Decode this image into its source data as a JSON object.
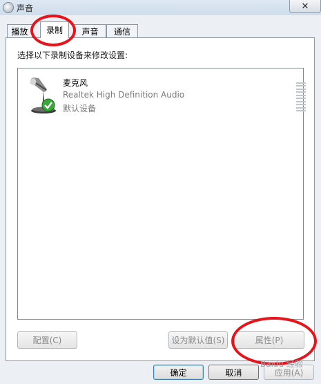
{
  "window": {
    "title": "声音",
    "close_glyph": "✕"
  },
  "tabs": [
    {
      "label": "播放",
      "active": false
    },
    {
      "label": "录制",
      "active": true
    },
    {
      "label": "声音",
      "active": false
    },
    {
      "label": "通信",
      "active": false
    }
  ],
  "recording": {
    "instruction": "选择以下录制设备来修改设置:",
    "device": {
      "name": "麦克风",
      "description": "Realtek High Definition Audio",
      "status": "默认设备",
      "icon": "microphone-icon",
      "badge_icon": "green-check-icon"
    },
    "buttons": {
      "configure": "配置(C)",
      "set_default": "设为默认值(S)",
      "properties": "属性(P)"
    }
  },
  "footer": {
    "ok": "确定",
    "cancel": "取消",
    "apply": "应用(A)"
  },
  "annotations": {
    "color": "#e8141b"
  },
  "watermark": "Baidu 经验"
}
